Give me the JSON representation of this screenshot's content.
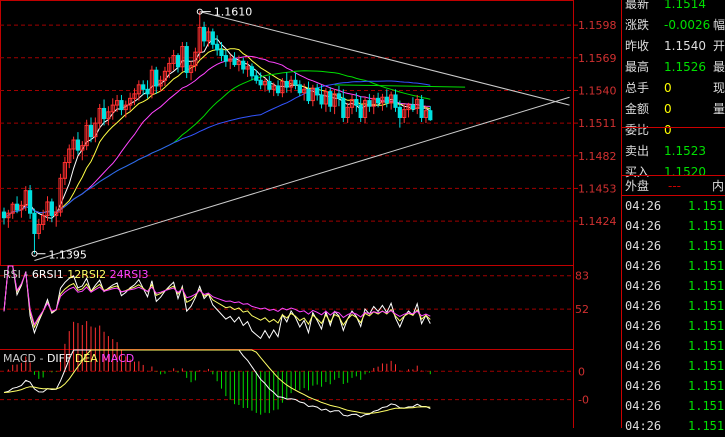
{
  "quote": {
    "rows": [
      {
        "label": "最新",
        "value": "1.1514",
        "label2": "",
        "color": "#00e000"
      },
      {
        "label": "涨跌",
        "value": "-0.0026",
        "label2": "幅",
        "color": "#00e000"
      },
      {
        "label": "昨收",
        "value": "1.1540",
        "label2": "开",
        "color": "#dddddd"
      },
      {
        "label": "最高",
        "value": "1.1526",
        "label2": "最",
        "color": "#00e000"
      },
      {
        "label": "总手",
        "value": "0",
        "label2": "现",
        "color": "#ffff00"
      },
      {
        "label": "金额",
        "value": "0",
        "label2": "量",
        "color": "#ffff00"
      },
      {
        "label": "委比",
        "value": "0",
        "label2": "",
        "color": "#ffff00"
      },
      {
        "label": "卖出",
        "value": "1.1523",
        "label2": "",
        "color": "#00e000"
      },
      {
        "label": "买入",
        "value": "1.1520",
        "label2": "",
        "color": "#00e000"
      }
    ],
    "header": {
      "left": "外盘",
      "mid": "---",
      "right": "内"
    },
    "ticks": [
      {
        "time": "04:26",
        "price": "1.151"
      },
      {
        "time": "04:26",
        "price": "1.151"
      },
      {
        "time": "04:26",
        "price": "1.151"
      },
      {
        "time": "04:26",
        "price": "1.151"
      },
      {
        "time": "04:26",
        "price": "1.151"
      },
      {
        "time": "04:26",
        "price": "1.151"
      },
      {
        "time": "04:26",
        "price": "1.151"
      },
      {
        "time": "04:26",
        "price": "1.151"
      },
      {
        "time": "04:26",
        "price": "1.151"
      },
      {
        "time": "04:26",
        "price": "1.151"
      },
      {
        "time": "04:26",
        "price": "1.151"
      },
      {
        "time": "04:26",
        "price": "1.151"
      }
    ]
  },
  "legends": {
    "rsi": [
      {
        "text": "RSI",
        "color": "#cccccc"
      },
      {
        "text": " - ",
        "color": "#cccccc"
      },
      {
        "text": "6RSI1",
        "color": "#ffffff"
      },
      {
        "text": " 12RSI2",
        "color": "#ffff66"
      },
      {
        "text": " 24RSI3",
        "color": "#ff44ff"
      }
    ],
    "macd": [
      {
        "text": "MACD",
        "color": "#cccccc"
      },
      {
        "text": " - ",
        "color": "#cccccc"
      },
      {
        "text": "DIFF",
        "color": "#ffffff"
      },
      {
        "text": " DEA",
        "color": "#ffff66"
      },
      {
        "text": " MACD",
        "color": "#ff44ff"
      }
    ]
  },
  "chart_data": [
    {
      "type": "candlestick",
      "title": "",
      "y_ticks": [
        "1.1598",
        "1.1569",
        "1.1540",
        "1.1511",
        "1.1482",
        "1.1453",
        "1.1424"
      ],
      "ylim": [
        1.1385,
        1.1615
      ],
      "annotations": [
        {
          "text": "1.1610",
          "bar": 45,
          "price": 1.161,
          "kind": "high"
        },
        {
          "text": "1.1395",
          "bar": 7,
          "price": 1.1395,
          "kind": "low"
        }
      ],
      "candles": [
        [
          1.1432,
          1.1436,
          1.1421,
          1.1427
        ],
        [
          1.1427,
          1.1434,
          1.1418,
          1.1431
        ],
        [
          1.1431,
          1.1441,
          1.1426,
          1.1439
        ],
        [
          1.1439,
          1.1446,
          1.1431,
          1.1434
        ],
        [
          1.1434,
          1.1442,
          1.1427,
          1.1438
        ],
        [
          1.1438,
          1.1455,
          1.1433,
          1.1451
        ],
        [
          1.1451,
          1.1456,
          1.1426,
          1.1431
        ],
        [
          1.1431,
          1.1435,
          1.1395,
          1.1413
        ],
        [
          1.1413,
          1.1426,
          1.1408,
          1.1421
        ],
        [
          1.1421,
          1.1434,
          1.1416,
          1.1429
        ],
        [
          1.1429,
          1.1446,
          1.1424,
          1.1441
        ],
        [
          1.1441,
          1.1444,
          1.1423,
          1.1429
        ],
        [
          1.1429,
          1.1437,
          1.1419,
          1.1432
        ],
        [
          1.1432,
          1.1466,
          1.1428,
          1.1462
        ],
        [
          1.1462,
          1.1481,
          1.1456,
          1.1476
        ],
        [
          1.1476,
          1.1492,
          1.1471,
          1.1488
        ],
        [
          1.1488,
          1.1499,
          1.1479,
          1.1496
        ],
        [
          1.1496,
          1.1503,
          1.1483,
          1.1487
        ],
        [
          1.1487,
          1.1495,
          1.1478,
          1.1491
        ],
        [
          1.1491,
          1.1514,
          1.1487,
          1.1509
        ],
        [
          1.1509,
          1.1516,
          1.1494,
          1.1499
        ],
        [
          1.1499,
          1.1516,
          1.1494,
          1.1511
        ],
        [
          1.1511,
          1.1528,
          1.1506,
          1.1524
        ],
        [
          1.1524,
          1.1532,
          1.1509,
          1.1515
        ],
        [
          1.1515,
          1.1526,
          1.1509,
          1.1521
        ],
        [
          1.1521,
          1.1533,
          1.1514,
          1.1527
        ],
        [
          1.1527,
          1.1536,
          1.1521,
          1.1531
        ],
        [
          1.1531,
          1.1536,
          1.1518,
          1.1523
        ],
        [
          1.1523,
          1.1531,
          1.1516,
          1.1527
        ],
        [
          1.1527,
          1.1538,
          1.1522,
          1.1533
        ],
        [
          1.1533,
          1.1542,
          1.1527,
          1.1537
        ],
        [
          1.1537,
          1.1549,
          1.1531,
          1.1545
        ],
        [
          1.1545,
          1.1549,
          1.1536,
          1.1541
        ],
        [
          1.1541,
          1.1549,
          1.1533,
          1.1537
        ],
        [
          1.1537,
          1.1562,
          1.1533,
          1.1558
        ],
        [
          1.1558,
          1.1561,
          1.1537,
          1.1544
        ],
        [
          1.1544,
          1.1553,
          1.1539,
          1.1549
        ],
        [
          1.1549,
          1.1561,
          1.1544,
          1.1557
        ],
        [
          1.1557,
          1.1569,
          1.1551,
          1.1564
        ],
        [
          1.1564,
          1.1576,
          1.1558,
          1.1571
        ],
        [
          1.1571,
          1.1573,
          1.1556,
          1.1561
        ],
        [
          1.1561,
          1.1583,
          1.1557,
          1.1579
        ],
        [
          1.1579,
          1.1583,
          1.1551,
          1.1556
        ],
        [
          1.1556,
          1.1566,
          1.1549,
          1.1562
        ],
        [
          1.1562,
          1.1578,
          1.1557,
          1.1574
        ],
        [
          1.1574,
          1.161,
          1.1567,
          1.1596
        ],
        [
          1.1596,
          1.1601,
          1.1579,
          1.1584
        ],
        [
          1.1584,
          1.1596,
          1.1579,
          1.1592
        ],
        [
          1.1592,
          1.1595,
          1.1577,
          1.1581
        ],
        [
          1.1581,
          1.1589,
          1.1571,
          1.1576
        ],
        [
          1.1576,
          1.1583,
          1.1566,
          1.1571
        ],
        [
          1.1571,
          1.1576,
          1.1561,
          1.1566
        ],
        [
          1.1566,
          1.1572,
          1.1559,
          1.1568
        ],
        [
          1.1568,
          1.1574,
          1.1561,
          1.1563
        ],
        [
          1.1563,
          1.1571,
          1.1557,
          1.1566
        ],
        [
          1.1566,
          1.1569,
          1.1555,
          1.1559
        ],
        [
          1.1559,
          1.1566,
          1.1552,
          1.1561
        ],
        [
          1.1561,
          1.1564,
          1.1549,
          1.1553
        ],
        [
          1.1553,
          1.1558,
          1.1546,
          1.1549
        ],
        [
          1.1549,
          1.1556,
          1.1541,
          1.1545
        ],
        [
          1.1545,
          1.1551,
          1.1539,
          1.1548
        ],
        [
          1.1548,
          1.1553,
          1.1538,
          1.1541
        ],
        [
          1.1541,
          1.1547,
          1.1535,
          1.1544
        ],
        [
          1.1544,
          1.1549,
          1.1535,
          1.1538
        ],
        [
          1.1538,
          1.1551,
          1.1534,
          1.1548
        ],
        [
          1.1548,
          1.1556,
          1.1538,
          1.1543
        ],
        [
          1.1543,
          1.1553,
          1.1538,
          1.1549
        ],
        [
          1.1549,
          1.1556,
          1.1541,
          1.1545
        ],
        [
          1.1545,
          1.1549,
          1.1535,
          1.1538
        ],
        [
          1.1538,
          1.1546,
          1.1531,
          1.1541
        ],
        [
          1.1541,
          1.1548,
          1.1528,
          1.1531
        ],
        [
          1.1531,
          1.1545,
          1.1526,
          1.1542
        ],
        [
          1.1542,
          1.1546,
          1.1531,
          1.1536
        ],
        [
          1.1536,
          1.1545,
          1.1524,
          1.1528
        ],
        [
          1.1528,
          1.1542,
          1.1521,
          1.1539
        ],
        [
          1.1539,
          1.1543,
          1.1521,
          1.1526
        ],
        [
          1.1526,
          1.1541,
          1.1519,
          1.1537
        ],
        [
          1.1537,
          1.1544,
          1.1526,
          1.1533
        ],
        [
          1.1533,
          1.1541,
          1.1512,
          1.1516
        ],
        [
          1.1516,
          1.1529,
          1.1511,
          1.1525
        ],
        [
          1.1525,
          1.1536,
          1.1519,
          1.1532
        ],
        [
          1.1532,
          1.1538,
          1.1521,
          1.1527
        ],
        [
          1.1527,
          1.1535,
          1.1512,
          1.1516
        ],
        [
          1.1516,
          1.1534,
          1.1511,
          1.1531
        ],
        [
          1.1531,
          1.1537,
          1.1521,
          1.1526
        ],
        [
          1.1526,
          1.1536,
          1.1519,
          1.1533
        ],
        [
          1.1533,
          1.1538,
          1.1525,
          1.1529
        ],
        [
          1.1529,
          1.1537,
          1.1522,
          1.1534
        ],
        [
          1.1534,
          1.1541,
          1.1525,
          1.1529
        ],
        [
          1.1529,
          1.1539,
          1.1523,
          1.1536
        ],
        [
          1.1536,
          1.1541,
          1.1521,
          1.1525
        ],
        [
          1.1525,
          1.1531,
          1.1507,
          1.1516
        ],
        [
          1.1516,
          1.1528,
          1.1511,
          1.1523
        ],
        [
          1.1523,
          1.1529,
          1.1516,
          1.1527
        ],
        [
          1.1527,
          1.1534,
          1.1521,
          1.1524
        ],
        [
          1.1524,
          1.1536,
          1.1519,
          1.1532
        ],
        [
          1.1532,
          1.1536,
          1.1512,
          1.1516
        ],
        [
          1.1516,
          1.1526,
          1.1511,
          1.1522
        ],
        [
          1.1522,
          1.1526,
          1.1513,
          1.1514
        ]
      ],
      "ma_lines": [
        {
          "color": "#ffffff",
          "period": 5
        },
        {
          "color": "#ffff44",
          "period": 10
        },
        {
          "color": "#ff44ff",
          "period": 20
        },
        {
          "color": "#00dd00",
          "period": 40
        },
        {
          "color": "#3355ff",
          "period": 60
        }
      ],
      "trendlines": [
        {
          "from": [
            45,
            1.161
          ],
          "to": [
            130,
            1.1527
          ],
          "color": "#cccccc"
        },
        {
          "from": [
            7,
            1.1389
          ],
          "to": [
            130,
            1.1534
          ],
          "color": "#cccccc"
        },
        {
          "from": [
            76,
            1.1545
          ],
          "to": [
            106,
            1.1543
          ],
          "color": "#00dd00"
        }
      ]
    },
    {
      "type": "line",
      "title": "RSI",
      "y_ticks": [
        "83",
        "52"
      ],
      "ylim": [
        15,
        92
      ],
      "series": [
        {
          "name": "6RSI1",
          "color": "#ffffff",
          "period": 6
        },
        {
          "name": "12RSI2",
          "color": "#ffff66",
          "period": 12
        },
        {
          "name": "24RSI3",
          "color": "#ff44ff",
          "period": 24
        }
      ]
    },
    {
      "type": "bar+line",
      "title": "MACD",
      "y_ticks": [
        "0",
        "-0"
      ],
      "ylim": [
        -0.0016,
        0.0006
      ],
      "series": [
        {
          "name": "DIFF",
          "color": "#ffffff"
        },
        {
          "name": "DEA",
          "color": "#ffff66"
        },
        {
          "name": "MACD",
          "color": "#ff44ff"
        }
      ]
    }
  ]
}
